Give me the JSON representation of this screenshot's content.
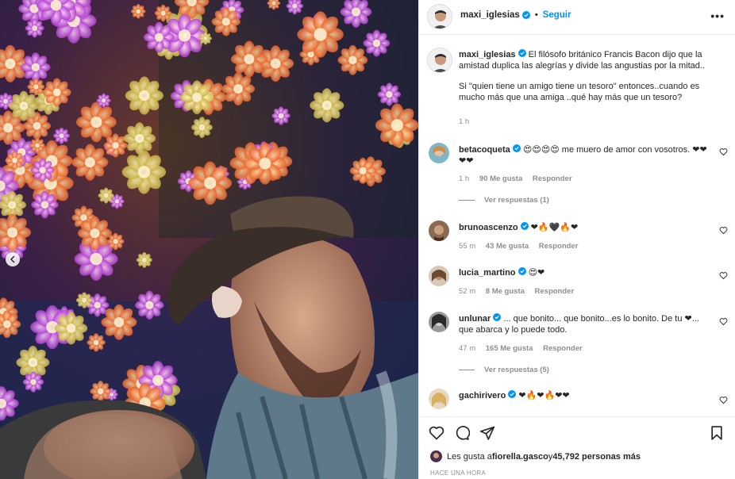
{
  "header": {
    "username": "maxi_iglesias",
    "separator": "•",
    "follow_label": "Seguir",
    "more_label": "•••"
  },
  "caption": {
    "username": "maxi_iglesias",
    "text_p1": "El filósofo británico Francis Bacon dijo que la amistad duplica las alegrías y divide las angustias por la mitad..",
    "text_p2": "Si \"quien tiene un amigo tiene un tesoro\" entonces..cuando es mucho más que una amiga ..qué hay más que un tesoro?",
    "time": "1 h"
  },
  "comments": [
    {
      "username": "betacoqueta",
      "text": "😍😍😍😍 me muero de amor con vosotros. ❤❤❤❤",
      "time": "1 h",
      "likes": "90 Me gusta",
      "reply": "Responder",
      "view_replies": "Ver respuestas (1)"
    },
    {
      "username": "brunoascenzo",
      "text": "❤🔥🖤🔥❤",
      "time": "55 m",
      "likes": "43 Me gusta",
      "reply": "Responder"
    },
    {
      "username": "lucia_martino",
      "text": "😍❤",
      "time": "52 m",
      "likes": "8 Me gusta",
      "reply": "Responder"
    },
    {
      "username": "unlunar",
      "text": "... que bonito... que bonito...es lo bonito. De tu ❤... que abarca y lo puede todo.",
      "time": "47 m",
      "likes": "165 Me gusta",
      "reply": "Responder",
      "view_replies": "Ver respuestas (5)"
    },
    {
      "username": "gachirivero",
      "text": "❤🔥❤🔥❤❤"
    }
  ],
  "footer": {
    "likes_prefix": "Les gusta a ",
    "likes_user": "fiorella.gasco",
    "likes_middle": " y ",
    "likes_count": "45,792 personas más",
    "timestamp": "HACE UNA HORA"
  },
  "icons": {
    "verified": "verified-badge-icon",
    "like": "heart-icon",
    "comment": "comment-icon",
    "share": "send-icon",
    "save": "bookmark-icon",
    "prev": "chevron-left-icon"
  },
  "colors": {
    "accent": "#0095f6",
    "muted": "#8e8e8e",
    "text": "#262626"
  }
}
